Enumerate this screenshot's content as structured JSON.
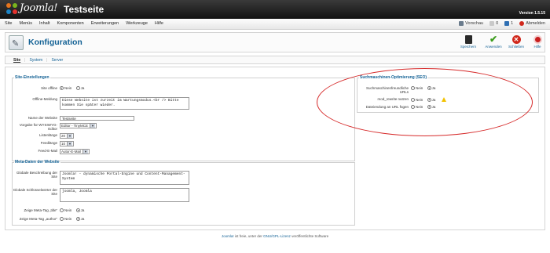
{
  "header": {
    "logo_text": "Joomla!",
    "site_title": "Testseite",
    "version": "Version 1.5.15"
  },
  "menu": {
    "items": [
      "Site",
      "Menüs",
      "Inhalt",
      "Komponenten",
      "Erweiterungen",
      "Werkzeuge",
      "Hilfe"
    ]
  },
  "status": {
    "preview": "Vorschau",
    "messages": "0",
    "users": "1",
    "logout": "Abmelden"
  },
  "toolbar": {
    "title": "Konfiguration",
    "buttons": [
      {
        "label": "Speichern",
        "icon": "save-icon",
        "color": "#2a2a2a"
      },
      {
        "label": "Anwenden",
        "icon": "checkmark-icon",
        "color": "#3d9d1e"
      },
      {
        "label": "Schließen",
        "icon": "close-icon",
        "color": "#d0281c"
      },
      {
        "label": "Hilfe",
        "icon": "help-icon",
        "color": "#c81e1e"
      }
    ]
  },
  "tabs": [
    "Site",
    "System",
    "Server"
  ],
  "site_settings": {
    "legend": "Site-Einstellungen",
    "offline_label": "Site offline",
    "offline_no": "Nein",
    "offline_yes": "Ja",
    "offline_message_label": "Offline-Meldung",
    "offline_message": "Diese Website ist zurzeit im Wartungsmodus.<br /> Bitte kommen Sie später wieder.",
    "site_name_label": "Name der Website",
    "site_name": "Testseite",
    "editor_label": "Vorgabe für WYSIWYG-Editor",
    "editor": "Editor - TinyMCE",
    "list_length_label": "Listenlänge",
    "list_length": "20",
    "feed_length_label": "Feedlänge",
    "feed_length": "10",
    "feed_email_label": "Feed-E-Mail",
    "feed_email": "Autor-E-Mail"
  },
  "meta": {
    "legend": "Meta-Daten der Website",
    "description_label": "Globale Beschreibung der Site",
    "description": "Joomla! - dynamische Portal-Engine und Content-Management-System",
    "keywords_label": "Globale Schlüsselwörter der Site",
    "keywords": "joomla, Joomla",
    "title_tag_label": "Zeige Meta-Tag „title“",
    "author_tag_label": "Zeige Meta-Tag „author“",
    "no": "Nein",
    "yes": "Ja"
  },
  "seo": {
    "legend": "Suchmaschinen-Optimierung (SEO)",
    "sef_label": "Suchmaschinenfreundliche URLs",
    "rewrite_label": "mod_rewrite nutzen",
    "suffix_label": "Dateiendung an URL fügen",
    "no": "Nein",
    "yes": "Ja"
  },
  "footer": {
    "link_joomla": "Joomla!",
    "text_mid": " ist freie, unter der ",
    "link_license": "GNU/GPL-Lizenz",
    "text_end": " veröffentlichte Software"
  },
  "colors": {
    "accent": "#146295",
    "annotation": "#d62a2a"
  }
}
